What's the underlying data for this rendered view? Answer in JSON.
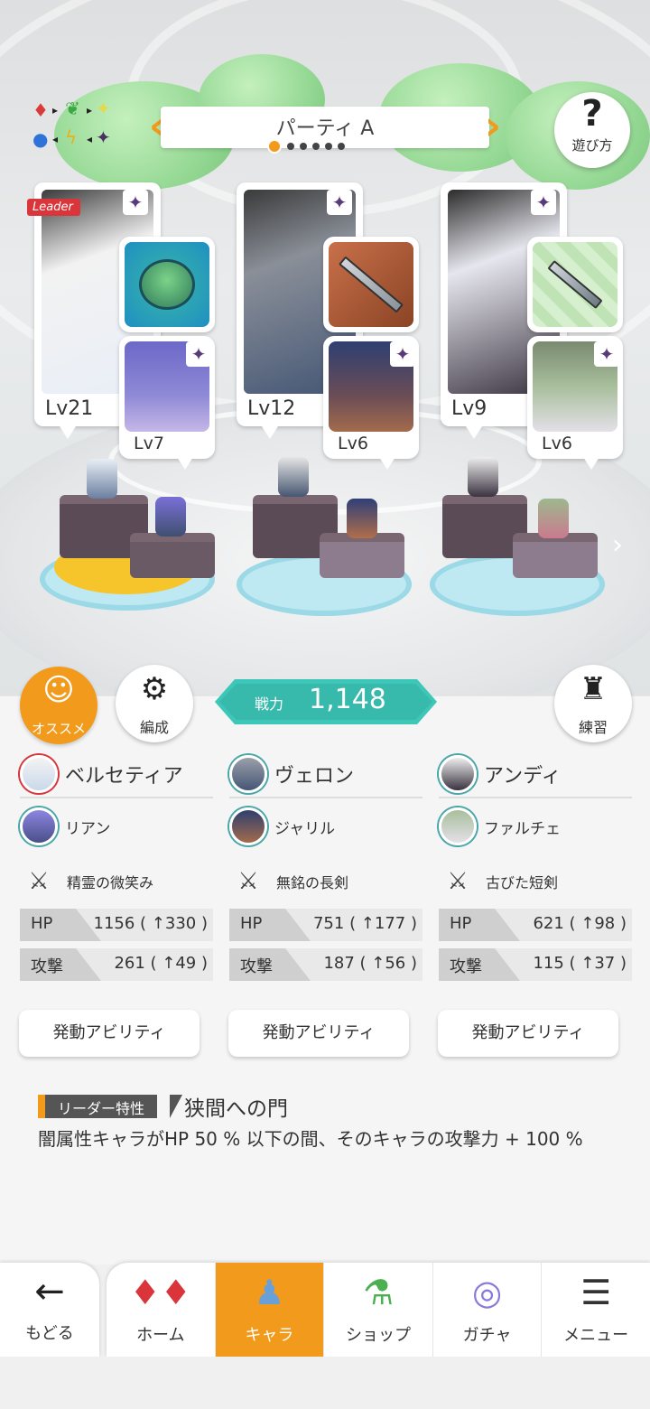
{
  "party": {
    "title": "パーティ A",
    "pages": 6,
    "active_page": 0
  },
  "help": {
    "label": "遊び方",
    "icon": "question-icon"
  },
  "leader_badge": "Leader",
  "cards": [
    {
      "lv": "Lv21",
      "sub_lv": "Lv7"
    },
    {
      "lv": "Lv12",
      "sub_lv": "Lv6"
    },
    {
      "lv": "Lv9",
      "sub_lv": "Lv6"
    }
  ],
  "actions": {
    "recommend": "オススメ",
    "formation": "編成",
    "practice": "練習"
  },
  "power": {
    "label": "戦力",
    "value": "1,148"
  },
  "columns": [
    {
      "main": "ベルセティア",
      "sub": "リアン",
      "equip": "精霊の微笑み",
      "hp_label": "HP",
      "hp": "1156 ( ↑330 )",
      "atk_label": "攻撃",
      "atk": "261 ( ↑49 )"
    },
    {
      "main": "ヴェロン",
      "sub": "ジャリル",
      "equip": "無銘の長剣",
      "hp_label": "HP",
      "hp": "751 ( ↑177 )",
      "atk_label": "攻撃",
      "atk": "187 ( ↑56 )"
    },
    {
      "main": "アンディ",
      "sub": "ファルチェ",
      "equip": "古びた短剣",
      "hp_label": "HP",
      "hp": "621 ( ↑98 )",
      "atk_label": "攻撃",
      "atk": "115 ( ↑37 )"
    }
  ],
  "ability_label": "発動アビリティ",
  "leader_skill": {
    "tag": "リーダー特性",
    "title": "狭間への門",
    "desc": "闇属性キャラがHP 50 % 以下の間、そのキャラの攻撃力 + 100 %"
  },
  "nav": {
    "back": "もどる",
    "tabs": [
      "ホーム",
      "キャラ",
      "ショップ",
      "ガチャ",
      "メニュー"
    ],
    "active": 1
  },
  "colors": {
    "accent": "#f29a1c",
    "power": "#3cc7b8",
    "leader_tag": "#d9353b"
  }
}
